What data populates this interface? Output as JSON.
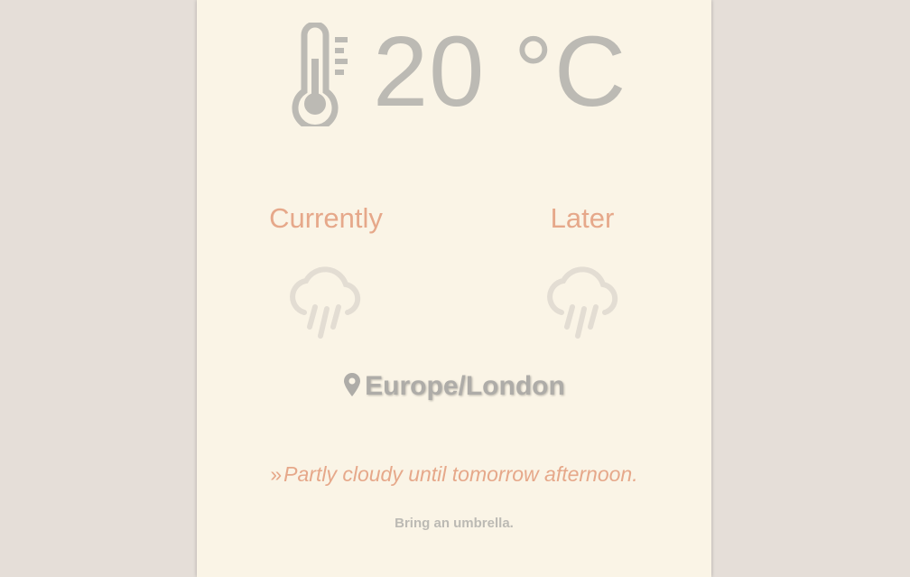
{
  "temperature": {
    "value": "20 °C",
    "icon": "thermometer-icon"
  },
  "forecast": {
    "current": {
      "label": "Currently",
      "icon": "rain-cloud-icon"
    },
    "later": {
      "label": "Later",
      "icon": "rain-cloud-icon"
    }
  },
  "location": {
    "icon": "map-pin-icon",
    "name": "Europe/London"
  },
  "summary": {
    "marker": "»",
    "text": "Partly cloudy until tomorrow afternoon."
  },
  "advice": "Bring an umbrella.",
  "colors": {
    "background": "#e5ded8",
    "card": "#faf4e6",
    "accent": "#e6a88a",
    "muted": "#bcbab4"
  }
}
